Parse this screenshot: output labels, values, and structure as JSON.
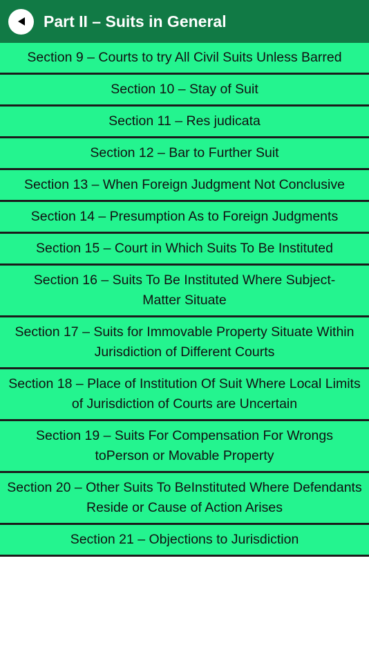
{
  "header": {
    "title": "Part II – Suits in General",
    "back_icon": "back-arrow-icon"
  },
  "colors": {
    "header_bg": "#117a45",
    "item_bg": "#24f48f",
    "divider": "#1b1b1b"
  },
  "sections": [
    {
      "label": "Section 9 – Courts to try All Civil Suits Unless Barred"
    },
    {
      "label": "Section 10 – Stay of Suit"
    },
    {
      "label": "Section 11 – Res judicata"
    },
    {
      "label": "Section 12 – Bar to Further Suit"
    },
    {
      "label": "Section 13 – When Foreign Judgment Not Conclusive"
    },
    {
      "label": "Section 14 – Presumption As to Foreign Judgments"
    },
    {
      "label": "Section 15 – Court in Which Suits To Be Instituted"
    },
    {
      "label": "Section 16 – Suits To Be Instituted Where Subject-Matter Situate"
    },
    {
      "label": "Section 17 – Suits for Immovable Property Situate Within Jurisdiction of Different Courts"
    },
    {
      "label": "Section 18 – Place of Institution Of Suit Where Local Limits of Jurisdiction of Courts are Uncertain"
    },
    {
      "label": "Section 19 – Suits For Compensation For Wrongs toPerson or Movable Property"
    },
    {
      "label": "Section 20 – Other Suits To BeInstituted Where Defendants Reside or Cause of Action Arises"
    },
    {
      "label": "Section 21 – Objections to Jurisdiction"
    }
  ]
}
